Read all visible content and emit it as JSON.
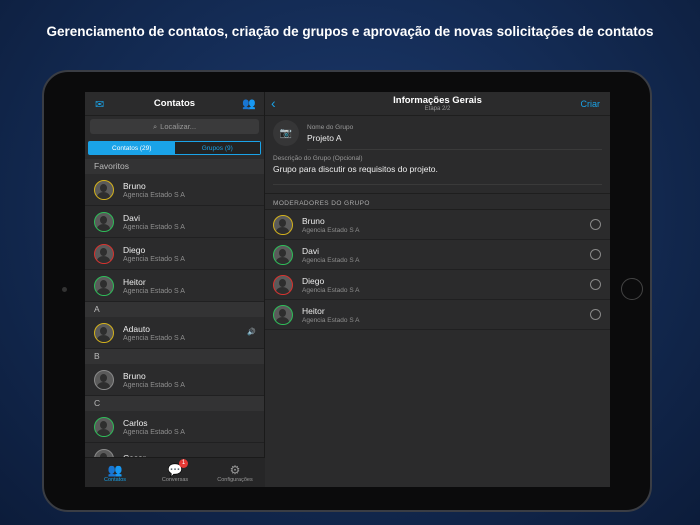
{
  "headline": "Gerenciamento de contatos, criação de grupos e aprovação de novas solicitações de contatos",
  "colors": {
    "accent": "#1aa3e8",
    "yellow": "#d4b21c",
    "green": "#2ebd59",
    "red": "#d8332f",
    "gray": "#8a8a8a"
  },
  "left": {
    "title": "Contatos",
    "search_placeholder": "Localizar...",
    "segments": [
      "Contatos (29)",
      "Grupos (9)"
    ],
    "sections": [
      {
        "label": "Favoritos",
        "items": [
          {
            "name": "Bruno",
            "company": "Agencia Estado S A",
            "status": "yellow"
          },
          {
            "name": "Davi",
            "company": "Agencia Estado S A",
            "status": "green"
          },
          {
            "name": "Diego",
            "company": "Agencia Estado S A",
            "status": "red"
          },
          {
            "name": "Heitor",
            "company": "Agencia Estado S A",
            "status": "green"
          }
        ]
      },
      {
        "label": "A",
        "items": [
          {
            "name": "Adauto",
            "company": "Agencia Estado S A",
            "status": "yellow"
          }
        ]
      },
      {
        "label": "B",
        "items": [
          {
            "name": "Bruno",
            "company": "Agencia Estado S A",
            "status": "gray"
          }
        ]
      },
      {
        "label": "C",
        "items": [
          {
            "name": "Carlos",
            "company": "Agencia Estado S A",
            "status": "green"
          },
          {
            "name": "Cesar",
            "company": "",
            "status": "gray"
          }
        ]
      }
    ],
    "tabs": [
      {
        "label": "Contatos"
      },
      {
        "label": "Conversas",
        "badge": "1"
      },
      {
        "label": "Configurações"
      }
    ]
  },
  "right": {
    "title": "Informações Gerais",
    "subtitle": "Etapa 2/2",
    "action": "Criar",
    "name_label": "Nome do Grupo",
    "name_value": "Projeto A",
    "desc_label": "Descrição do Grupo (Opcional)",
    "desc_value": "Grupo para discutir os requisitos do projeto.",
    "moderators_header": "MODERADORES DO GRUPO",
    "moderators": [
      {
        "name": "Bruno",
        "company": "Agencia Estado S A",
        "status": "yellow"
      },
      {
        "name": "Davi",
        "company": "Agencia Estado S A",
        "status": "green"
      },
      {
        "name": "Diego",
        "company": "Agencia Estado S A",
        "status": "red"
      },
      {
        "name": "Heitor",
        "company": "Agencia Estado S A",
        "status": "green"
      }
    ]
  }
}
